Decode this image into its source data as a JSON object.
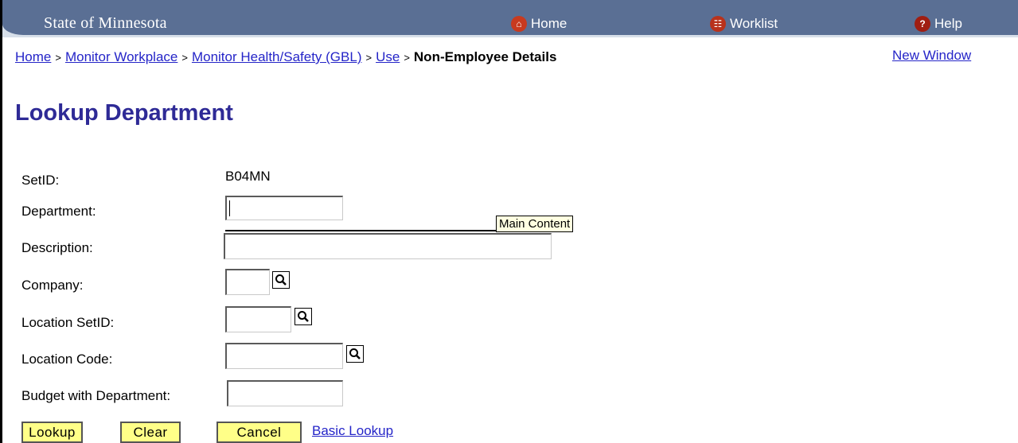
{
  "header": {
    "site_title": "State of Minnesota",
    "home_label": "Home",
    "worklist_label": "Worklist",
    "help_label": "Help"
  },
  "breadcrumb": {
    "items": [
      "Home",
      "Monitor Workplace",
      "Monitor Health/Safety (GBL)",
      "Use"
    ],
    "separator": ">",
    "current": "Non-Employee Details"
  },
  "new_window_label": "New Window",
  "page_title": "Lookup Department",
  "form": {
    "setid_label": "SetID:",
    "setid_value": "B04MN",
    "department_label": "Department:",
    "department_value": "",
    "description_label": "Description:",
    "description_value": "",
    "company_label": "Company:",
    "company_value": "",
    "location_setid_label": "Location SetID:",
    "location_setid_value": "",
    "location_code_label": "Location Code:",
    "location_code_value": "",
    "budget_label": "Budget with Department:",
    "budget_value": ""
  },
  "tooltip": "Main Content",
  "buttons": {
    "lookup": "Lookup",
    "clear": "Clear",
    "cancel": "Cancel",
    "basic_lookup": "Basic Lookup"
  },
  "icons": {
    "home": "home-icon",
    "worklist": "worklist-icon",
    "help": "help-icon",
    "lookup": "magnifier-icon"
  },
  "colors": {
    "header_bg": "#5a6f94",
    "link": "#2525c8",
    "title": "#2e2a96",
    "button_bg": "#ffff88",
    "tooltip_bg": "#ffffe1"
  }
}
